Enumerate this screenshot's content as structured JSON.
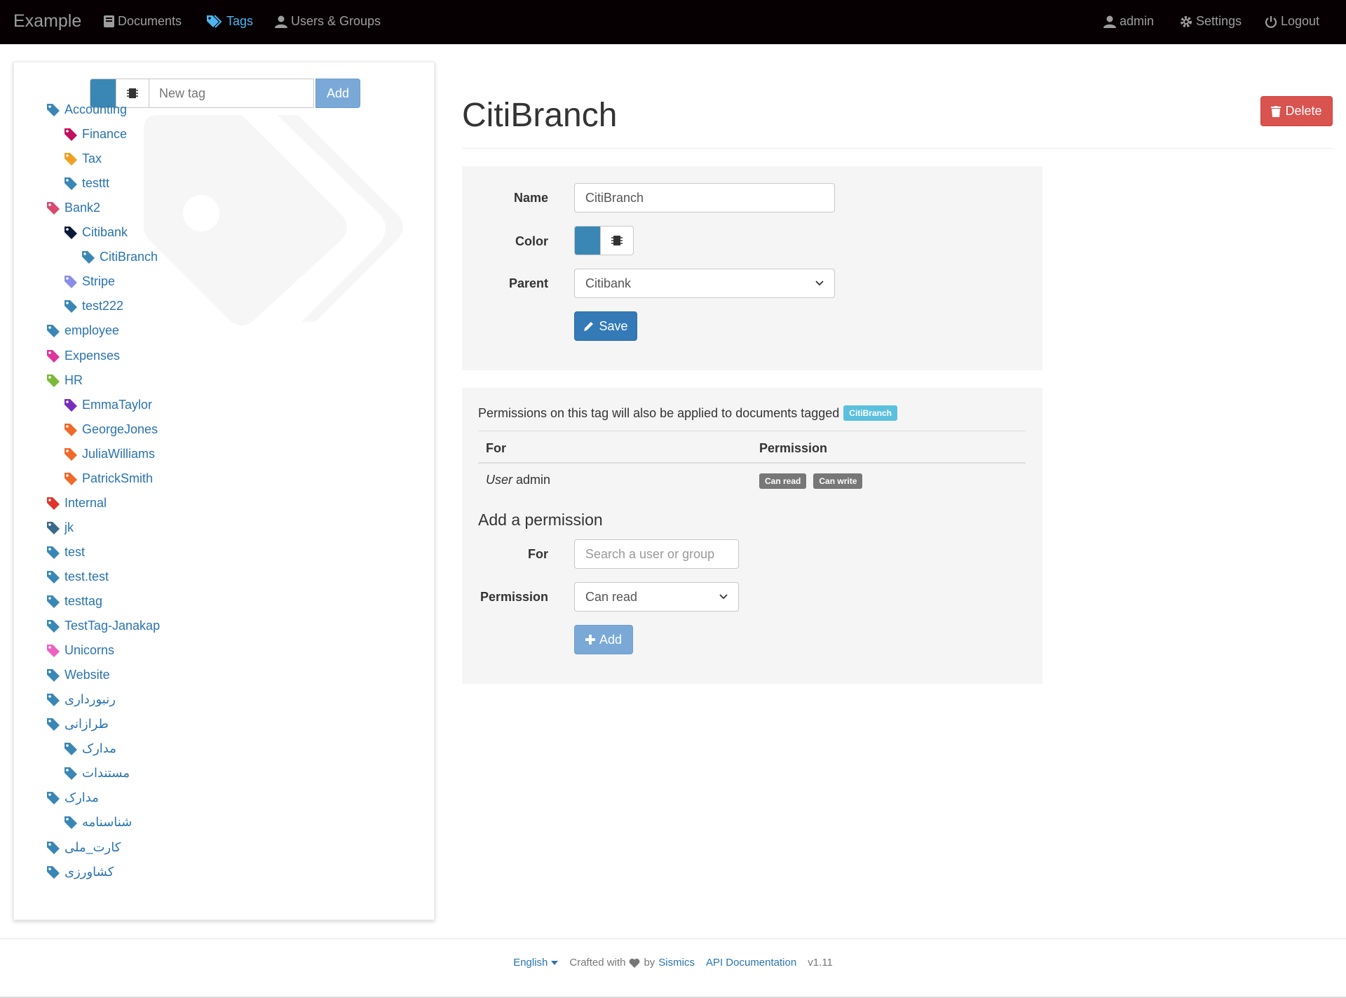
{
  "navbar": {
    "brand": "Example",
    "documents": "Documents",
    "tags": "Tags",
    "users_groups": "Users & Groups",
    "admin": "admin",
    "settings": "Settings",
    "logout": "Logout"
  },
  "sidebar": {
    "new_tag_placeholder": "New tag",
    "add_label": "Add",
    "tags": [
      {
        "label": "Accounting",
        "color": "#3a87b5",
        "depth": 0
      },
      {
        "label": "Finance",
        "color": "#c0105e",
        "depth": 1
      },
      {
        "label": "Tax",
        "color": "#f0a020",
        "depth": 1
      },
      {
        "label": "testtt",
        "color": "#3a87b5",
        "depth": 1
      },
      {
        "label": "Bank2",
        "color": "#d84a6e",
        "depth": 0
      },
      {
        "label": "Citibank",
        "color": "#0b1a3a",
        "depth": 1
      },
      {
        "label": "CitiBranch",
        "color": "#3a87b5",
        "depth": 2
      },
      {
        "label": "Stripe",
        "color": "#8a8ee8",
        "depth": 1
      },
      {
        "label": "test222",
        "color": "#3a87b5",
        "depth": 1
      },
      {
        "label": "employee",
        "color": "#3a87b5",
        "depth": 0
      },
      {
        "label": "Expenses",
        "color": "#e0359a",
        "depth": 0
      },
      {
        "label": "HR",
        "color": "#7ab83a",
        "depth": 0
      },
      {
        "label": "EmmaTaylor",
        "color": "#7a2ec0",
        "depth": 1
      },
      {
        "label": "GeorgeJones",
        "color": "#f06a2a",
        "depth": 1
      },
      {
        "label": "JuliaWilliams",
        "color": "#f06a2a",
        "depth": 1
      },
      {
        "label": "PatrickSmith",
        "color": "#f06a2a",
        "depth": 1
      },
      {
        "label": "Internal",
        "color": "#e0352a",
        "depth": 0
      },
      {
        "label": "jk",
        "color": "#3a6a8a",
        "depth": 0
      },
      {
        "label": "test",
        "color": "#3a87b5",
        "depth": 0
      },
      {
        "label": "test.test",
        "color": "#3a87b5",
        "depth": 0
      },
      {
        "label": "testtag",
        "color": "#3a87b5",
        "depth": 0
      },
      {
        "label": "TestTag-Janakap",
        "color": "#3a87b5",
        "depth": 0
      },
      {
        "label": "Unicorns",
        "color": "#f060c0",
        "depth": 0
      },
      {
        "label": "Website",
        "color": "#3a87b5",
        "depth": 0
      },
      {
        "label": "رنبورداری",
        "color": "#3a87b5",
        "depth": 0
      },
      {
        "label": "طرازانی",
        "color": "#3a87b5",
        "depth": 0
      },
      {
        "label": "مدارک",
        "color": "#3a87b5",
        "depth": 1
      },
      {
        "label": "مستندات",
        "color": "#3a87b5",
        "depth": 1
      },
      {
        "label": "مدارک",
        "color": "#3a87b5",
        "depth": 0
      },
      {
        "label": "شناسنامه",
        "color": "#3a87b5",
        "depth": 1
      },
      {
        "label": "کارت_ملی",
        "color": "#3a87b5",
        "depth": 0
      },
      {
        "label": "کشاورزی",
        "color": "#3a87b5",
        "depth": 0
      }
    ]
  },
  "main": {
    "title": "CitiBranch",
    "delete_label": "Delete",
    "form": {
      "name_label": "Name",
      "name_value": "CitiBranch",
      "color_label": "Color",
      "color_value": "#3a87b5",
      "parent_label": "Parent",
      "parent_value": "Citibank",
      "save_label": "Save"
    },
    "permissions": {
      "note": "Permissions on this tag will also be applied to documents tagged",
      "tag_badge": "CitiBranch",
      "col_for": "For",
      "col_permission": "Permission",
      "row_type": "User",
      "row_name": "admin",
      "perm_read": "Can read",
      "perm_write": "Can write",
      "add_heading": "Add a permission",
      "for_label": "For",
      "for_placeholder": "Search a user or group",
      "permission_label": "Permission",
      "permission_value": "Can read",
      "add_label": "Add"
    }
  },
  "footer": {
    "language": "English",
    "crafted_with": "Crafted with",
    "by": "by",
    "company": "Sismics",
    "api_docs": "API Documentation",
    "version": "v1.11"
  }
}
